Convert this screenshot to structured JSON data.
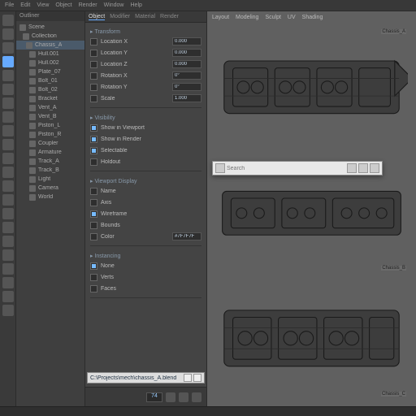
{
  "menu": {
    "items": [
      "File",
      "Edit",
      "View",
      "Object",
      "Render",
      "Window",
      "Help"
    ]
  },
  "rail": {
    "count": 22,
    "selected": 3
  },
  "outline": {
    "header": "Outliner",
    "items": [
      {
        "label": "Scene",
        "sel": false
      },
      {
        "label": "Collection",
        "sel": false
      },
      {
        "label": "Chassis_A",
        "sel": true
      },
      {
        "label": "Hull.001",
        "sel": false
      },
      {
        "label": "Hull.002",
        "sel": false
      },
      {
        "label": "Plate_07",
        "sel": false
      },
      {
        "label": "Bolt_01",
        "sel": false
      },
      {
        "label": "Bolt_02",
        "sel": false
      },
      {
        "label": "Bracket",
        "sel": false
      },
      {
        "label": "Vent_A",
        "sel": false
      },
      {
        "label": "Vent_B",
        "sel": false
      },
      {
        "label": "Piston_L",
        "sel": false
      },
      {
        "label": "Piston_R",
        "sel": false
      },
      {
        "label": "Coupler",
        "sel": false
      },
      {
        "label": "Armature",
        "sel": false
      },
      {
        "label": "Track_A",
        "sel": false
      },
      {
        "label": "Track_B",
        "sel": false
      },
      {
        "label": "Light",
        "sel": false
      },
      {
        "label": "Camera",
        "sel": false
      },
      {
        "label": "World",
        "sel": false
      }
    ]
  },
  "props": {
    "tabs": [
      "Object",
      "Modifier",
      "Material",
      "Render"
    ],
    "active_tab": 0,
    "groups": [
      {
        "title": "Transform",
        "fields": [
          {
            "label": "Location X",
            "value": "0.000",
            "check": false
          },
          {
            "label": "Location Y",
            "value": "0.000",
            "check": false
          },
          {
            "label": "Location Z",
            "value": "0.000",
            "check": false
          },
          {
            "label": "Rotation X",
            "value": "0°",
            "check": false
          },
          {
            "label": "Rotation Y",
            "value": "0°",
            "check": false
          },
          {
            "label": "Scale",
            "value": "1.000",
            "check": false
          }
        ]
      },
      {
        "title": "Visibility",
        "fields": [
          {
            "label": "Show in Viewport",
            "value": "",
            "check": true
          },
          {
            "label": "Show in Render",
            "value": "",
            "check": true
          },
          {
            "label": "Selectable",
            "value": "",
            "check": true
          },
          {
            "label": "Holdout",
            "value": "",
            "check": false
          }
        ]
      },
      {
        "title": "Viewport Display",
        "fields": [
          {
            "label": "Name",
            "value": "",
            "check": false
          },
          {
            "label": "Axis",
            "value": "",
            "check": false
          },
          {
            "label": "Wireframe",
            "value": "",
            "check": true
          },
          {
            "label": "Bounds",
            "value": "",
            "check": false
          },
          {
            "label": "Color",
            "value": "#7F7F7F",
            "check": false
          }
        ]
      },
      {
        "title": "Instancing",
        "fields": [
          {
            "label": "None",
            "value": "",
            "check": true
          },
          {
            "label": "Verts",
            "value": "",
            "check": false
          },
          {
            "label": "Faces",
            "value": "",
            "check": false
          }
        ]
      }
    ],
    "path": {
      "text": "C:\\Projects\\mech\\chassis_A.blend"
    },
    "footer": {
      "frame": "74",
      "icons": 3
    }
  },
  "viewport": {
    "tabs": [
      "Layout",
      "Modeling",
      "Sculpt",
      "UV",
      "Shading"
    ],
    "labels": {
      "a": "Chassis_A",
      "b": "Chassis_B",
      "c": "Chassis_C"
    },
    "search": {
      "placeholder": "Search",
      "value": ""
    }
  }
}
